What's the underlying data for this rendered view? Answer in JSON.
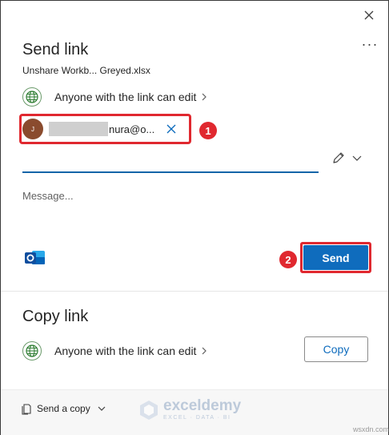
{
  "dialog": {
    "title": "Send link",
    "filename": "Unshare Workb... Greyed.xlsx",
    "permission_label": "Anyone with the link can edit",
    "recipient": {
      "avatar_initial": "J",
      "email_visible": "nura@o..."
    },
    "message_placeholder": "Message...",
    "send_label": "Send",
    "copy_section_title": "Copy link",
    "copy_permission_label": "Anyone with the link can edit",
    "copy_label": "Copy",
    "footer_send_copy": "Send a copy"
  },
  "annotations": {
    "badge_1": "1",
    "badge_2": "2"
  },
  "watermark": {
    "name": "exceldemy",
    "tagline": "EXCEL · DATA · BI"
  },
  "corner_mark": "wsxdn.com",
  "colors": {
    "accent": "#0f6cbd",
    "highlight": "#e0282f",
    "avatar": "#8a4b2e"
  },
  "icons": [
    "close-icon",
    "more-icon",
    "globe-icon",
    "chevron-right-icon",
    "dismiss-icon",
    "pencil-icon",
    "chevron-down-icon",
    "outlook-icon",
    "document-copy-icon"
  ]
}
